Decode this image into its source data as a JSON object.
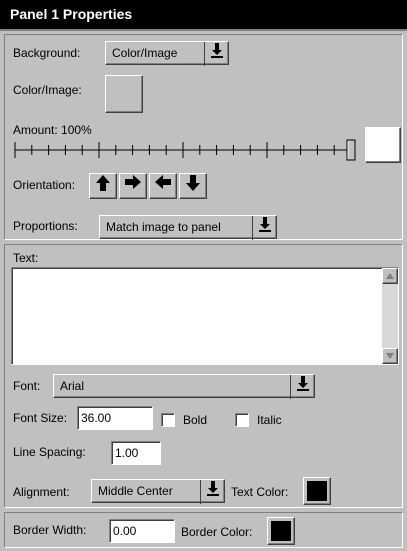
{
  "title": "Panel 1 Properties",
  "background": {
    "label": "Background:",
    "value": "Color/Image"
  },
  "color_image": {
    "label": "Color/Image:"
  },
  "amount": {
    "label": "Amount: 100%",
    "value_percent": 100,
    "preview_color": "#ffffff"
  },
  "orientation": {
    "label": "Orientation:",
    "buttons": [
      "up-arrow",
      "right-arrow",
      "left-arrow",
      "down-arrow"
    ]
  },
  "proportions": {
    "label": "Proportions:",
    "value": "Match image to panel"
  },
  "text": {
    "label": "Text:",
    "value": ""
  },
  "font": {
    "label": "Font:",
    "value": "Arial"
  },
  "font_size": {
    "label": "Font Size:",
    "value": "36.00"
  },
  "bold": {
    "label": "Bold",
    "checked": false
  },
  "italic": {
    "label": "Italic",
    "checked": false
  },
  "line_spacing": {
    "label": "Line Spacing:",
    "value": "1.00"
  },
  "alignment": {
    "label": "Alignment:",
    "value": "Middle Center"
  },
  "text_color": {
    "label": "Text Color:",
    "color": "#000000"
  },
  "border_width": {
    "label": "Border Width:",
    "value": "0.00"
  },
  "border_color": {
    "label": "Border Color:",
    "color": "#000000"
  }
}
